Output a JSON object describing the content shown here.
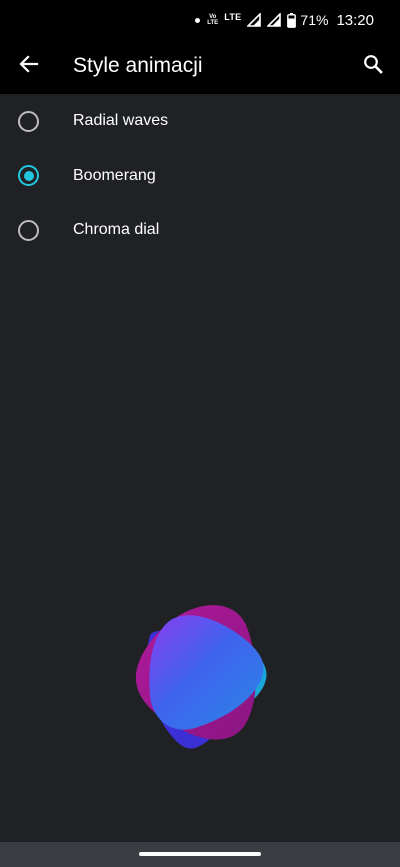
{
  "status_bar": {
    "volte_top": "Vo",
    "volte_bottom": "LTE",
    "network": "LTE",
    "battery_percent": "71%",
    "time": "13:20",
    "icons": [
      "notification-dot",
      "volte-icon",
      "signal-icon",
      "signal-icon",
      "battery-icon"
    ]
  },
  "app_bar": {
    "title": "Style animacji",
    "back_icon": "arrow-left-icon",
    "search_icon": "search-icon"
  },
  "options": [
    {
      "label": "Radial waves",
      "selected": false
    },
    {
      "label": "Boomerang",
      "selected": true
    },
    {
      "label": "Chroma dial",
      "selected": false
    }
  ],
  "colors": {
    "background": "#1f2124",
    "app_bar": "#000000",
    "accent": "#22c6df",
    "radio_unselected": "#bdbdbd",
    "nav_bar": "#3a3d41",
    "preview_blob_magenta": "#a0178f",
    "preview_blob_blue": "#2f78e6",
    "preview_blob_indigo": "#3b2fd6"
  },
  "preview": {
    "style": "Boomerang"
  }
}
